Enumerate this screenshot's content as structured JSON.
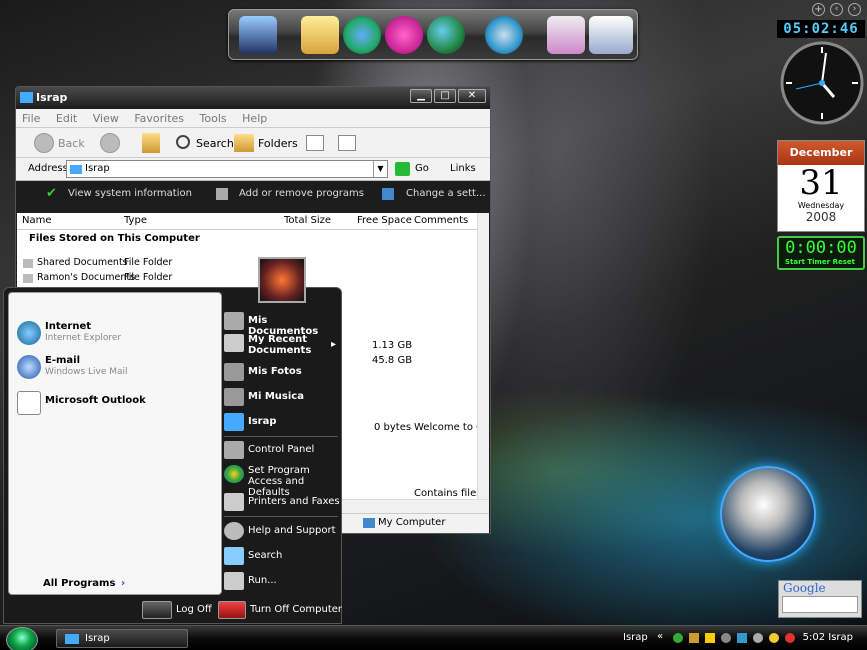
{
  "explorer": {
    "title": "Israp",
    "menu": [
      "File",
      "Edit",
      "View",
      "Favorites",
      "Tools",
      "Help"
    ],
    "toolbar": {
      "back": "Back",
      "search": "Search",
      "folders": "Folders"
    },
    "address": {
      "label": "Address",
      "value": "Israp",
      "go": "Go",
      "links": "Links"
    },
    "tasks": [
      "View system information",
      "Add or remove programs",
      "Change a sett..."
    ],
    "columns": [
      "Name",
      "Type",
      "Total Size",
      "Free Space",
      "Comments"
    ],
    "group_header": "Files Stored on This Computer",
    "rows": [
      {
        "name": "Shared Documents",
        "type": "File Folder"
      },
      {
        "name": "Ramon's Documents",
        "type": "File Folder"
      }
    ],
    "drives": [
      {
        "total": "1.13 GB"
      },
      {
        "total": "45.8 GB"
      },
      {
        "total": "0 bytes",
        "comment": "Welcome to Cu"
      }
    ],
    "status_text": "Contains files s",
    "status_location": "My Computer"
  },
  "start_menu": {
    "pinned": [
      {
        "title": "Internet",
        "subtitle": "Internet Explorer"
      },
      {
        "title": "E-mail",
        "subtitle": "Windows Live Mail"
      },
      {
        "title": "Microsoft Outlook",
        "subtitle": ""
      }
    ],
    "all_programs": "All Programs",
    "right": [
      {
        "label": "Mis Documentos",
        "bold": true
      },
      {
        "label": "My Recent Documents",
        "bold": true
      },
      {
        "label": "Mis Fotos",
        "bold": true
      },
      {
        "label": "Mi Musica",
        "bold": true
      },
      {
        "label": "Israp",
        "bold": true
      },
      {
        "label": "Control Panel",
        "bold": false
      },
      {
        "label": "Set Program Access and Defaults",
        "bold": false
      },
      {
        "label": "Printers and Faxes",
        "bold": false
      },
      {
        "label": "Help and Support",
        "bold": false
      },
      {
        "label": "Search",
        "bold": false
      },
      {
        "label": "Run...",
        "bold": false
      }
    ],
    "log_off": "Log Off",
    "turn_off": "Turn Off Computer"
  },
  "gadgets": {
    "digital_time": "05:02:46",
    "calendar": {
      "month": "December",
      "day": "31",
      "weekday": "Wednesday",
      "year": "2008"
    },
    "timer": {
      "display": "0:00:00",
      "start": "Start Timer",
      "reset": "Reset"
    },
    "google_label": "Google"
  },
  "taskbar": {
    "task_label": "Israp",
    "tray_label": "Israp",
    "clock": "5:02 Israp"
  },
  "colors": {
    "accent_blue": "#1e7fd1",
    "calendar_red": "#c2461f",
    "timer_green": "#33ff33"
  }
}
